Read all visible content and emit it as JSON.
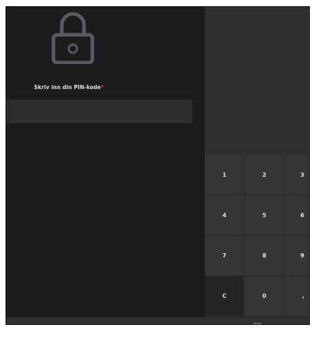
{
  "pin_screen": {
    "prompt": "Skriv inn din PIN-kode",
    "required_marker": "*",
    "pin_value": "",
    "icon": "lock-icon"
  },
  "keypad": {
    "keys": [
      "1",
      "2",
      "3",
      "4",
      "5",
      "6",
      "7",
      "8",
      "9",
      "C",
      "0",
      ","
    ],
    "ok_label": "OK"
  },
  "colors": {
    "background": "#1b1c1e",
    "keypad": "#353638",
    "required": "#d43a3a"
  }
}
